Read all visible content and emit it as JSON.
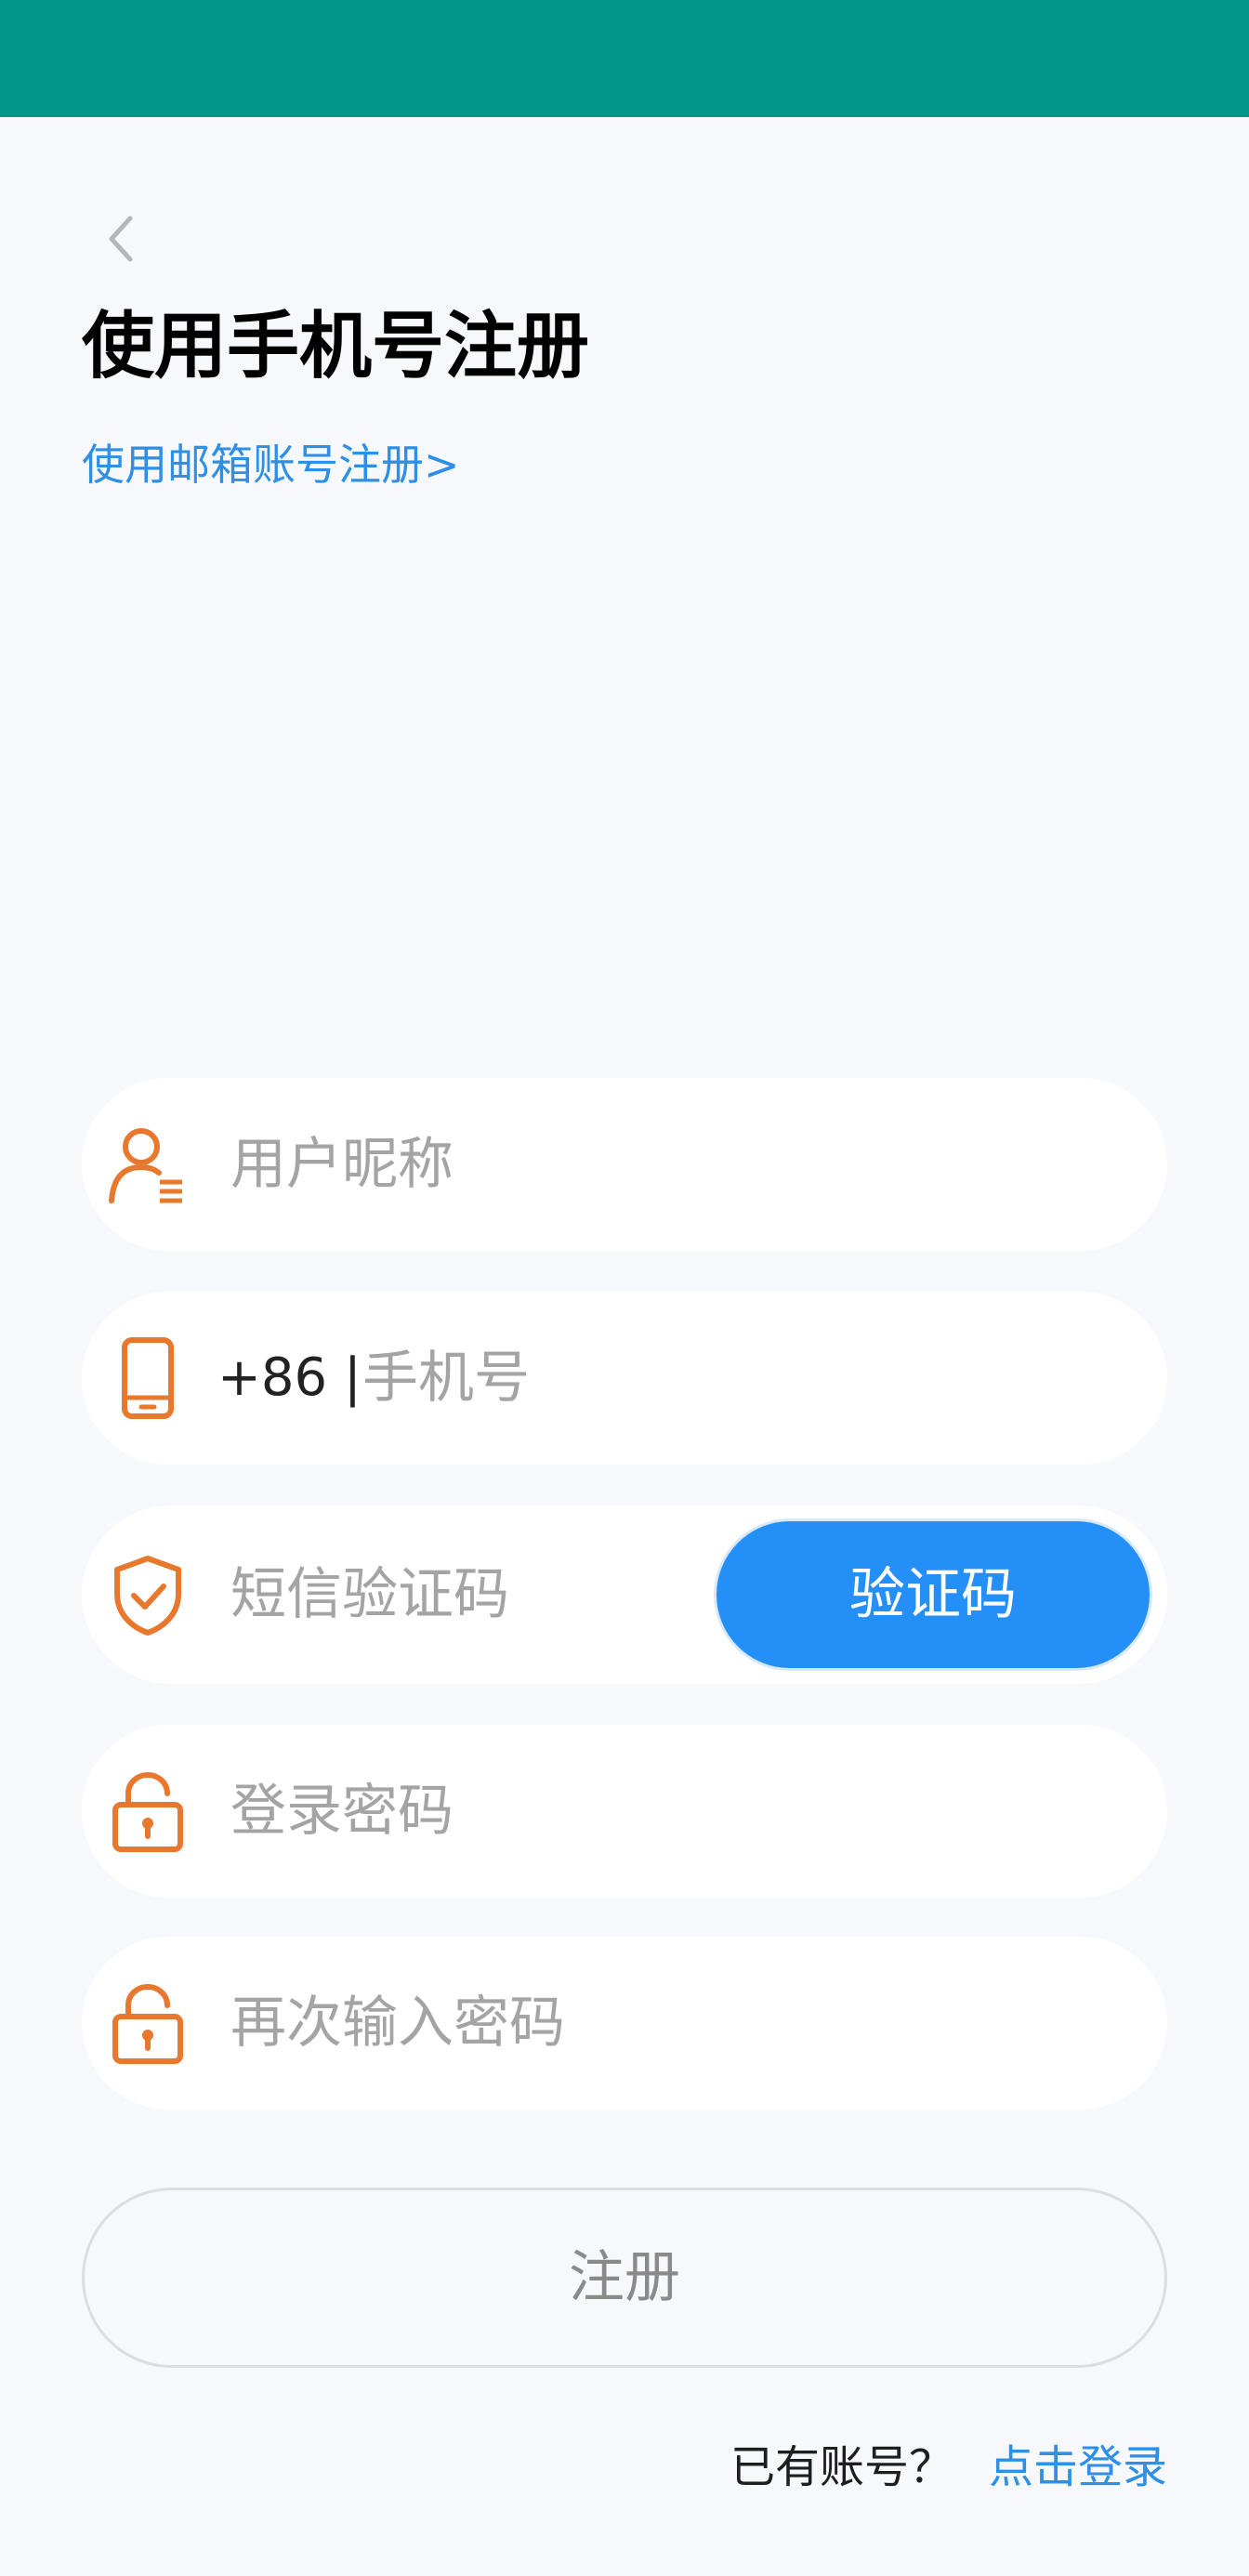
{
  "header": {
    "title": "使用手机号注册",
    "email_link": "使用邮箱账号注册>"
  },
  "form": {
    "nickname_placeholder": "用户昵称",
    "phone_prefix": "+86 |",
    "phone_placeholder": "手机号",
    "sms_placeholder": "短信验证码",
    "get_code_label": "验证码",
    "password_placeholder": "登录密码",
    "confirm_password_placeholder": "再次输入密码"
  },
  "actions": {
    "register_label": "注册",
    "have_account_text": "已有账号？",
    "login_link": "点击登录"
  },
  "colors": {
    "status_bar": "#009688",
    "accent_blue": "#2490f7",
    "icon_orange": "#e8782e"
  },
  "icons": {
    "back": "chevron-left-icon",
    "user": "user-list-icon",
    "phone": "phone-icon",
    "shield": "shield-check-icon",
    "lock": "lock-icon"
  }
}
